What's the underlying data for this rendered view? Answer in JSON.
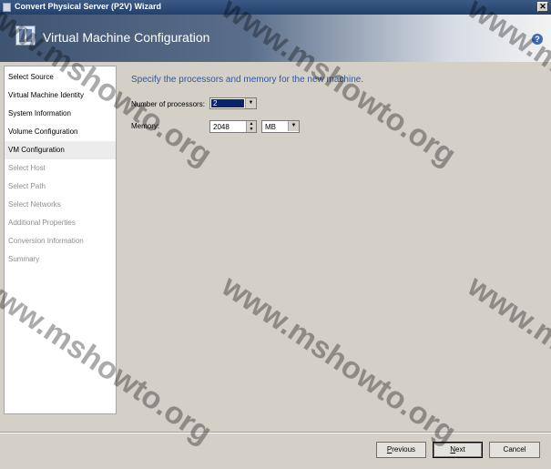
{
  "window": {
    "title": "Convert Physical Server (P2V) Wizard",
    "close_glyph": "✕"
  },
  "banner": {
    "title": "Virtual Machine Configuration",
    "help_glyph": "?"
  },
  "nav": {
    "items": [
      {
        "label": "Select Source",
        "state": "done"
      },
      {
        "label": "Virtual Machine Identity",
        "state": "done"
      },
      {
        "label": "System Information",
        "state": "done"
      },
      {
        "label": "Volume Configuration",
        "state": "done"
      },
      {
        "label": "VM Configuration",
        "state": "current"
      },
      {
        "label": "Select Host",
        "state": "pending"
      },
      {
        "label": "Select Path",
        "state": "pending"
      },
      {
        "label": "Select Networks",
        "state": "pending"
      },
      {
        "label": "Additional Properties",
        "state": "pending"
      },
      {
        "label": "Conversion Information",
        "state": "pending"
      },
      {
        "label": "Summary",
        "state": "pending"
      }
    ]
  },
  "main": {
    "heading": "Specify the processors and memory for the new machine.",
    "processors": {
      "label": "Number of processors:",
      "value": "2"
    },
    "memory": {
      "label": "Memory:",
      "value": "2048",
      "unit": "MB"
    }
  },
  "footer": {
    "previous": {
      "pre": "",
      "key": "P",
      "post": "revious"
    },
    "next": {
      "pre": "",
      "key": "N",
      "post": "ext"
    },
    "cancel": "Cancel"
  },
  "watermark": "www.mshowto.org",
  "colors": {
    "heading": "#2f56a6",
    "selection": "#0a246a",
    "dialog_bg": "#d4d0c8"
  }
}
